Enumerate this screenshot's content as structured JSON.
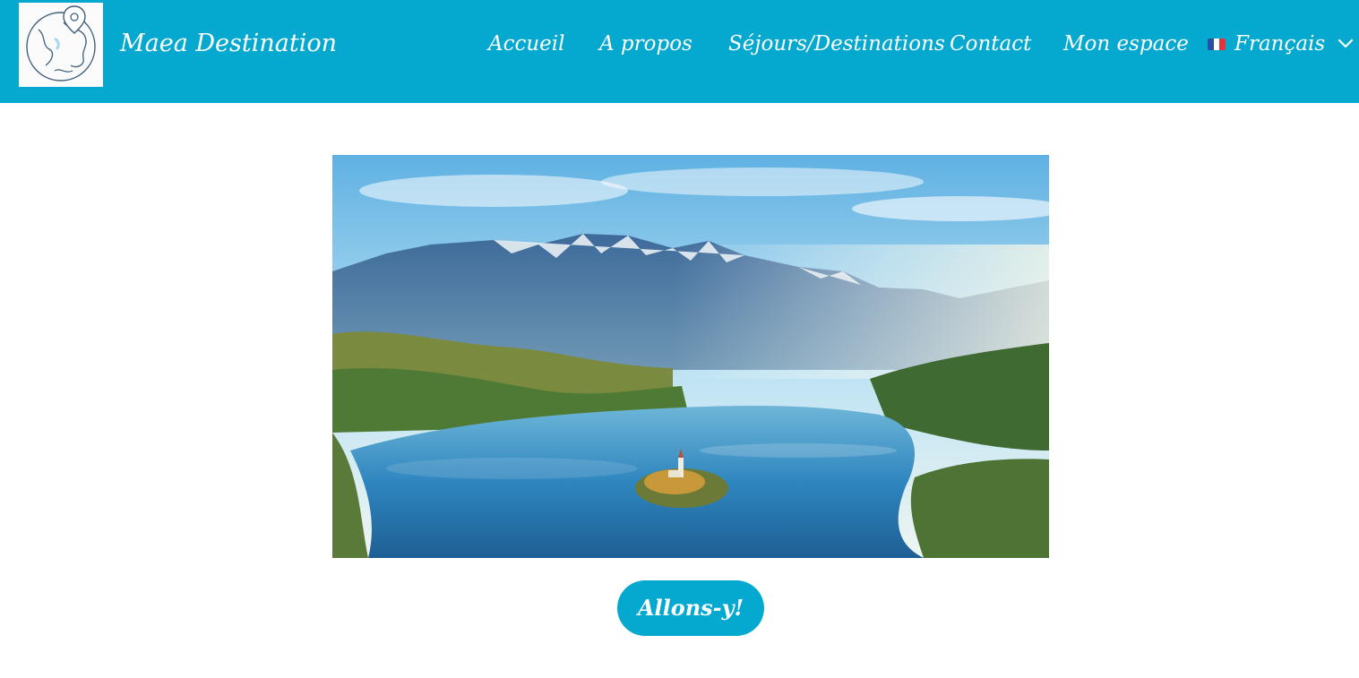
{
  "brand": {
    "logo_icon": "globe-pin-icon",
    "title": "Maea Destination"
  },
  "nav": {
    "items": [
      {
        "label": "Accueil"
      },
      {
        "label": "A propos"
      },
      {
        "label": "Séjours/Destinations"
      },
      {
        "label": "Contact"
      },
      {
        "label": "Mon espace"
      }
    ],
    "language": {
      "label": "Français",
      "flag_icon": "france-flag-icon",
      "chevron_icon": "chevron-down-icon"
    }
  },
  "hero": {
    "alt": "lake-island-mountains-image"
  },
  "cta": {
    "label": "Allons-y!"
  },
  "colors": {
    "brand": "#05a9cf",
    "text_on_brand": "#ffffff",
    "background": "#ffffff"
  }
}
